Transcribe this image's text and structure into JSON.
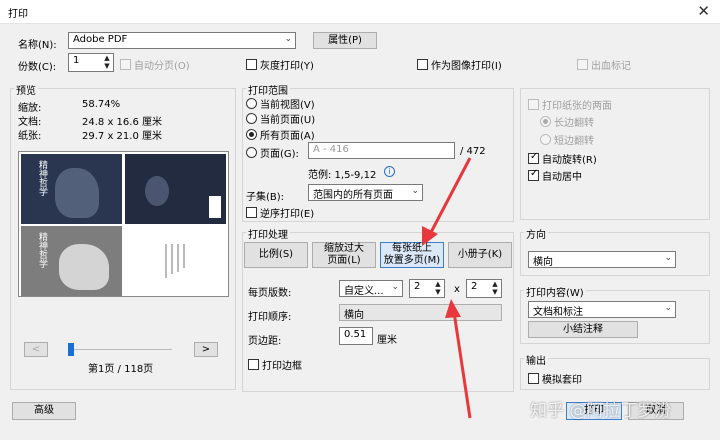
{
  "window": {
    "title": "打印",
    "close_symbol": "✕"
  },
  "printer": {
    "name_label": "名称(N):",
    "name_value": "Adobe PDF",
    "properties_label": "属性(P)"
  },
  "copies": {
    "label": "份数(C):",
    "value": "1",
    "collate_label": "自动分页(O)",
    "grayscale_label": "灰度打印(Y)",
    "as_image_label": "作为图像打印(I)",
    "bleed_label": "出血标记"
  },
  "preview": {
    "title": "预览",
    "zoom_label": "缩放:",
    "zoom_value": "58.74%",
    "doc_label": "文档:",
    "doc_value": "24.8 x 16.6 厘米",
    "paper_label": "纸张:",
    "paper_value": "29.7 x 21.0 厘米",
    "thumb_text_1": "精神哲学",
    "thumb_text_3": "精神哲学",
    "prev_symbol": "<",
    "next_symbol": ">",
    "page_indicator": "第1页 / 118页"
  },
  "range": {
    "title": "打印范围",
    "current_view": "当前视图(V)",
    "current_page": "当前页面(U)",
    "all_pages": "所有页面(A)",
    "pages_label": "页面(G):",
    "pages_placeholder": "A - 416",
    "total_pages": "/ 472",
    "example": "范例: 1,5-9,12",
    "info_icon": "i",
    "subset_label": "子集(B):",
    "subset_value": "范围内的所有页面",
    "reverse_label": "逆序打印(E)"
  },
  "two_sided": {
    "both_sides_label": "打印纸张的两面",
    "long_edge": "长边翻转",
    "short_edge": "短边翻转",
    "auto_rotate": "自动旋转(R)",
    "auto_center": "自动居中"
  },
  "handling": {
    "title": "打印处理",
    "tabs": [
      "比例(S)",
      "缩放过大\n页面(L)",
      "每张纸上\n放置多页(M)",
      "小册子(K)"
    ],
    "pages_per_sheet_label": "每页版数:",
    "pages_per_sheet_value": "自定义...",
    "cols": "2",
    "times": "x",
    "rows": "2",
    "order_label": "打印顺序:",
    "order_value": "横向",
    "margin_label": "页边距:",
    "margin_value": "0.51",
    "margin_unit": "厘米",
    "border_label": "打印边框"
  },
  "orientation": {
    "title": "方向",
    "value": "横向"
  },
  "content": {
    "title": "打印内容(W)",
    "value": "文档和标注",
    "summarize_label": "小结注释"
  },
  "output": {
    "title": "输出",
    "simulate_label": "模拟套印"
  },
  "footer": {
    "advanced_label": "高级",
    "print_label": "打印",
    "cancel_label": "取消"
  },
  "watermark": "知乎 @阿拉丁罗汾",
  "colors": {
    "annotation_arrow": "#e8373d",
    "tab_selected": "#dbe8f7",
    "tab_border": "#3c7fc9"
  }
}
